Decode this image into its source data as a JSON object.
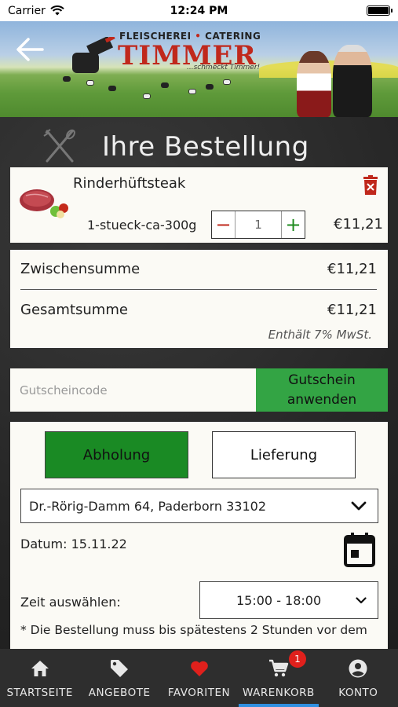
{
  "status_bar": {
    "carrier": "Carrier",
    "time": "12:24 PM"
  },
  "banner": {
    "logo_top_left": "FLEISCHEREI",
    "logo_top_dot": "•",
    "logo_top_right": "CATERING",
    "logo_main": "TIMMER",
    "logo_slogan": "...schmeckt Timmer!"
  },
  "page": {
    "title": "Ihre Bestellung"
  },
  "cart_item": {
    "name": "Rinderhüftsteak",
    "variant": "1-stueck-ca-300g",
    "quantity": "1",
    "minus": "−",
    "plus": "+",
    "price": "€11,21"
  },
  "totals": {
    "subtotal_label": "Zwischensumme",
    "subtotal_value": "€11,21",
    "total_label": "Gesamtsumme",
    "total_value": "€11,21",
    "vat_note": "Enthält 7% MwSt."
  },
  "coupon": {
    "placeholder": "Gutscheincode",
    "button_label": "Gutschein\nanwenden"
  },
  "delivery": {
    "pickup_label": "Abholung",
    "delivery_label": "Lieferung",
    "selected_mode": "Abholung",
    "address": "Dr.-Rörig-Damm 64, Paderborn 33102",
    "date_label": "Datum: 15.11.22",
    "time_label": "Zeit auswählen:",
    "time_value": "15:00 - 18:00",
    "note": "* Die Bestellung muss bis spätestens 2 Stunden vor dem"
  },
  "tabs": [
    {
      "label": "STARTSEITE",
      "icon": "home-icon"
    },
    {
      "label": "ANGEBOTE",
      "icon": "tag-icon"
    },
    {
      "label": "FAVORITEN",
      "icon": "heart-icon"
    },
    {
      "label": "WARENKORB",
      "icon": "cart-icon",
      "badge": "1",
      "active": true
    },
    {
      "label": "KONTO",
      "icon": "account-icon"
    }
  ],
  "colors": {
    "brand_red": "#c0281c",
    "green_primary": "#1a8a24",
    "green_coupon": "#33a444",
    "active_tab": "#2f8fe0"
  }
}
